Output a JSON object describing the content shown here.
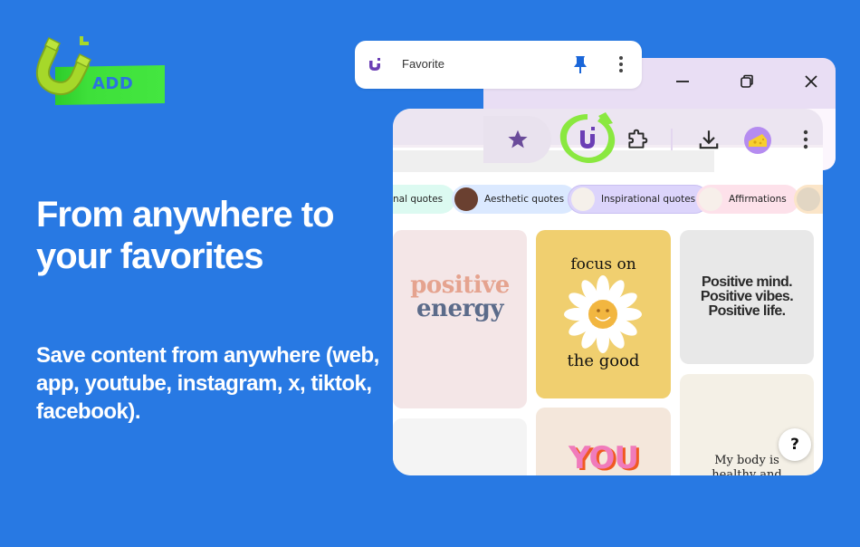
{
  "logo": {
    "icon": "magnet-icon",
    "tape_label": "ADD"
  },
  "hero": {
    "title": "From anywhere to your favorites",
    "subtitle": "Save content from anywhere (web, app, youtube, instagram, x, tiktok, facebook)."
  },
  "favorite_popup": {
    "label": "Favorite",
    "icons": [
      "magnet-icon",
      "pin-icon",
      "more-vertical-icon"
    ],
    "pin_color": "#1a66d9"
  },
  "window_controls": [
    "minimize-icon",
    "restore-icon",
    "close-icon"
  ],
  "toolbar": {
    "icons": [
      "star-icon",
      "magnet-extension-icon",
      "puzzle-extensions-icon",
      "download-icon",
      "profile-avatar-icon",
      "more-vertical-icon"
    ],
    "star_color": "#6a4b9a",
    "extension_ring_color": "#7ee83a"
  },
  "chips": [
    {
      "label": "nal quotes",
      "bg": "#dcfaf1",
      "thumb": ""
    },
    {
      "label": "Aesthetic quotes",
      "bg": "#dbe9ff",
      "thumb": "#6a4030"
    },
    {
      "label": "Inspirational quotes",
      "bg": "#dcd4fb",
      "thumb": "#f5f0ea"
    },
    {
      "label": "Affirmations",
      "bg": "#fde1ea",
      "thumb": "#f7efea"
    },
    {
      "label": "",
      "bg": "#fbe5c8",
      "thumb": "#e2d6c3"
    }
  ],
  "tiles": {
    "positive_energy": {
      "line1": "positive",
      "line2": "energy"
    },
    "focus_on_the_good": {
      "top": "focus on",
      "bottom": "the good"
    },
    "positive_mind": {
      "lines": [
        "Positive mind.",
        "Positive vibes.",
        "Positive life."
      ]
    },
    "you": {
      "text": "YOU"
    },
    "my_body": {
      "lines": [
        "My body is",
        "healthy and"
      ]
    }
  },
  "help_button": {
    "label": "?"
  },
  "colors": {
    "background": "#2879e3",
    "accent_green": "#3ee03a",
    "brand_purple": "#6a3fb0"
  }
}
